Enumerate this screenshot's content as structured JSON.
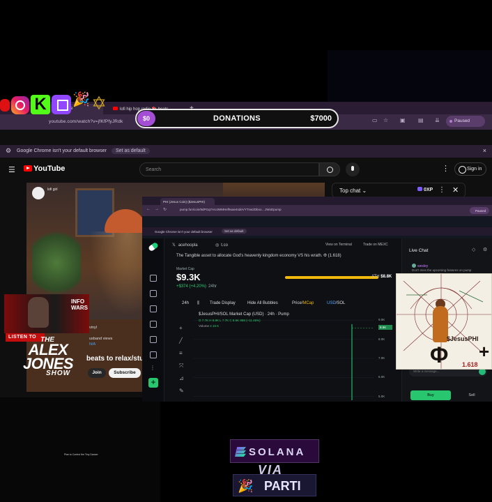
{
  "outer_browser": {
    "tab1_label": "Google Se",
    "tab2_label": "lofi hip hop radio 📚 beats",
    "new_tab": "+",
    "url": "youtube.com/watch?v=jfKfPfyJRdk",
    "paused_label": "Paused",
    "default_notice": "Google Chrome isn't your default browser",
    "set_default_label": "Set as default",
    "close_notice": "×"
  },
  "donation": {
    "current": "$0",
    "label": "DONATIONS",
    "goal": "$7000"
  },
  "overlay_logos": [
    "youtube-icon",
    "instagram-icon",
    "kick-icon",
    "twitch-icon",
    "party-popper-icon",
    "star-of-david-icon"
  ],
  "youtube": {
    "logo_text": "YouTube",
    "search_placeholder": "Search",
    "sign_in": "Sign in",
    "channel_name": "lofi girl",
    "video_title": "beats to relax/stud",
    "side_texts": [
      "vinyl",
      "usband views",
      "N/A"
    ],
    "join": "Join",
    "subscribe": "Subscribe",
    "top_chat": "Top chat",
    "chat_badge": "0XP"
  },
  "alex_jones": {
    "listen_to": "LISTEN TO",
    "the": "THE",
    "name": "ALEX JONES",
    "show": "SHOW",
    "infowars": "INFO WARS"
  },
  "inner_browser": {
    "tab_label": "PHI (Jesus Coin) ($JesusPHI)",
    "url": "pump.fun/coin/9dPGq7ArvJWMHef9uae4sdeVYTnw2Dboo…JWoDpump",
    "paused_label": "Paused",
    "default_notice": "Google Chrome isn't your default browser",
    "set_default_label": "Set as default"
  },
  "coin": {
    "x_handle": "acehoopla",
    "site": "t.co",
    "view_on_terminal": "View on Terminal",
    "trade_on": "Trade on MEXC",
    "description": "The Tangible asset to allocate God's heavenly kingdom economy VS his wrath. Φ (1.618)",
    "market_cap_label": "Market Cap",
    "market_cap": "$9.3K",
    "change": "+$374 (+4.20%)",
    "change_period": "24hr",
    "ath_label": "ATH",
    "ath_value": "$8.8K",
    "ath_progress": 1.0
  },
  "toolbar": {
    "interval": "24h",
    "trade_display": "Trade Display",
    "hide_bubbles": "Hide All Bubbles",
    "price": "Price",
    "mcap": "MCap",
    "usd": "USD",
    "sol": "SOL"
  },
  "chart_header": {
    "title": "$JesusPHI/SOL Market Cap (USD) · 24h · Pump",
    "ohlc": "O 7.7K  H 8.8K  L 7.7K  C 8.6K  888 (+11.46%)",
    "volume_label": "Volume",
    "volume_value": "2.16 K"
  },
  "chart_data": {
    "type": "line",
    "title": "$JesusPHI/SOL Market Cap (USD) · 24h · Pump",
    "ylabel": "",
    "yticks": [
      "9.0K",
      "8.0K",
      "7.0K",
      "6.0K",
      "5.0K"
    ],
    "current_label": "8.6K",
    "ylim": [
      4.8,
      9.2
    ],
    "series": [
      {
        "values": [
          7.7,
          8.8,
          8.6
        ]
      }
    ]
  },
  "live_chat": {
    "title": "Live Chat",
    "user": "wesley",
    "message": "Don't miss the upcoming features on pump",
    "input_placeholder": "Write a message...",
    "buy": "Buy",
    "sell": "Sell"
  },
  "artwork": {
    "title": "$JesusPHI",
    "phi": "Φ",
    "ratio": "1.618",
    "cross": "+"
  },
  "brand": {
    "solana": "SOLANA",
    "via": "VIA",
    "parti": "PARTI"
  },
  "footer_tiny": "Plan to Control the Tiny Dancer"
}
